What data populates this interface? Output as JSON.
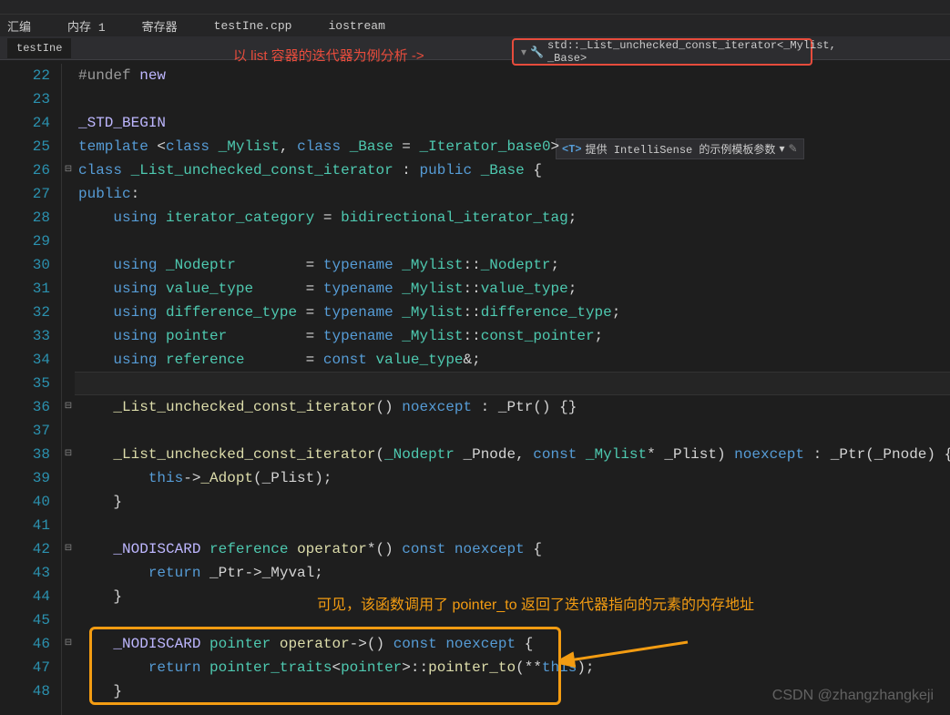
{
  "toolbar": {
    "items": [
      "汇编",
      "内存 1",
      "寄存器",
      "testIne.cpp",
      "iostream"
    ]
  },
  "tab": {
    "label": "testIne"
  },
  "annotation_top": "以 list 容器的迭代器为例分析 ->",
  "breadcrumb": {
    "text": "std::_List_unchecked_const_iterator<_Mylist, _Base>"
  },
  "hint": {
    "prefix": "<T>",
    "text": "提供 IntelliSense 的示例模板参数"
  },
  "line_start": 22,
  "lines": [
    [
      {
        "c": "pp",
        "t": "#undef"
      },
      {
        "c": "op",
        "t": " "
      },
      {
        "c": "mc",
        "t": "new"
      }
    ],
    [],
    [
      {
        "c": "mc",
        "t": "_STD_BEGIN"
      }
    ],
    [
      {
        "c": "kw",
        "t": "template"
      },
      {
        "c": "op",
        "t": " <"
      },
      {
        "c": "kw",
        "t": "class"
      },
      {
        "c": "op",
        "t": " "
      },
      {
        "c": "tp",
        "t": "_Mylist"
      },
      {
        "c": "op",
        "t": ", "
      },
      {
        "c": "kw",
        "t": "class"
      },
      {
        "c": "op",
        "t": " "
      },
      {
        "c": "tp",
        "t": "_Base"
      },
      {
        "c": "op",
        "t": " = "
      },
      {
        "c": "tp",
        "t": "_Iterator_base0"
      },
      {
        "c": "op",
        "t": ">"
      }
    ],
    [
      {
        "c": "kw",
        "t": "class"
      },
      {
        "c": "op",
        "t": " "
      },
      {
        "c": "tp",
        "t": "_List_unchecked_const_iterator"
      },
      {
        "c": "op",
        "t": " : "
      },
      {
        "c": "kw",
        "t": "public"
      },
      {
        "c": "op",
        "t": " "
      },
      {
        "c": "tp",
        "t": "_Base"
      },
      {
        "c": "op",
        "t": " {"
      }
    ],
    [
      {
        "c": "kw",
        "t": "public"
      },
      {
        "c": "op",
        "t": ":"
      }
    ],
    [
      {
        "c": "op",
        "t": "    "
      },
      {
        "c": "kw",
        "t": "using"
      },
      {
        "c": "op",
        "t": " "
      },
      {
        "c": "tp",
        "t": "iterator_category"
      },
      {
        "c": "op",
        "t": " = "
      },
      {
        "c": "tp",
        "t": "bidirectional_iterator_tag"
      },
      {
        "c": "op",
        "t": ";"
      }
    ],
    [],
    [
      {
        "c": "op",
        "t": "    "
      },
      {
        "c": "kw",
        "t": "using"
      },
      {
        "c": "op",
        "t": " "
      },
      {
        "c": "tp",
        "t": "_Nodeptr"
      },
      {
        "c": "op",
        "t": "        = "
      },
      {
        "c": "kw",
        "t": "typename"
      },
      {
        "c": "op",
        "t": " "
      },
      {
        "c": "tp",
        "t": "_Mylist"
      },
      {
        "c": "op",
        "t": "::"
      },
      {
        "c": "tp",
        "t": "_Nodeptr"
      },
      {
        "c": "op",
        "t": ";"
      }
    ],
    [
      {
        "c": "op",
        "t": "    "
      },
      {
        "c": "kw",
        "t": "using"
      },
      {
        "c": "op",
        "t": " "
      },
      {
        "c": "tp",
        "t": "value_type"
      },
      {
        "c": "op",
        "t": "      = "
      },
      {
        "c": "kw",
        "t": "typename"
      },
      {
        "c": "op",
        "t": " "
      },
      {
        "c": "tp",
        "t": "_Mylist"
      },
      {
        "c": "op",
        "t": "::"
      },
      {
        "c": "tp",
        "t": "value_type"
      },
      {
        "c": "op",
        "t": ";"
      }
    ],
    [
      {
        "c": "op",
        "t": "    "
      },
      {
        "c": "kw",
        "t": "using"
      },
      {
        "c": "op",
        "t": " "
      },
      {
        "c": "tp",
        "t": "difference_type"
      },
      {
        "c": "op",
        "t": " = "
      },
      {
        "c": "kw",
        "t": "typename"
      },
      {
        "c": "op",
        "t": " "
      },
      {
        "c": "tp",
        "t": "_Mylist"
      },
      {
        "c": "op",
        "t": "::"
      },
      {
        "c": "tp",
        "t": "difference_type"
      },
      {
        "c": "op",
        "t": ";"
      }
    ],
    [
      {
        "c": "op",
        "t": "    "
      },
      {
        "c": "kw",
        "t": "using"
      },
      {
        "c": "op",
        "t": " "
      },
      {
        "c": "tp",
        "t": "pointer"
      },
      {
        "c": "op",
        "t": "         = "
      },
      {
        "c": "kw",
        "t": "typename"
      },
      {
        "c": "op",
        "t": " "
      },
      {
        "c": "tp",
        "t": "_Mylist"
      },
      {
        "c": "op",
        "t": "::"
      },
      {
        "c": "tp",
        "t": "const_pointer"
      },
      {
        "c": "op",
        "t": ";"
      }
    ],
    [
      {
        "c": "op",
        "t": "    "
      },
      {
        "c": "kw",
        "t": "using"
      },
      {
        "c": "op",
        "t": " "
      },
      {
        "c": "tp",
        "t": "reference"
      },
      {
        "c": "op",
        "t": "       = "
      },
      {
        "c": "kw",
        "t": "const"
      },
      {
        "c": "op",
        "t": " "
      },
      {
        "c": "tp",
        "t": "value_type"
      },
      {
        "c": "op",
        "t": "&;"
      }
    ],
    [],
    [
      {
        "c": "op",
        "t": "    "
      },
      {
        "c": "fn",
        "t": "_List_unchecked_const_iterator"
      },
      {
        "c": "op",
        "t": "() "
      },
      {
        "c": "kw",
        "t": "noexcept"
      },
      {
        "c": "op",
        "t": " : "
      },
      {
        "c": "id",
        "t": "_Ptr"
      },
      {
        "c": "op",
        "t": "() {}"
      }
    ],
    [],
    [
      {
        "c": "op",
        "t": "    "
      },
      {
        "c": "fn",
        "t": "_List_unchecked_const_iterator"
      },
      {
        "c": "op",
        "t": "("
      },
      {
        "c": "tp",
        "t": "_Nodeptr"
      },
      {
        "c": "op",
        "t": " "
      },
      {
        "c": "id",
        "t": "_Pnode"
      },
      {
        "c": "op",
        "t": ", "
      },
      {
        "c": "kw",
        "t": "const"
      },
      {
        "c": "op",
        "t": " "
      },
      {
        "c": "tp",
        "t": "_Mylist"
      },
      {
        "c": "op",
        "t": "* "
      },
      {
        "c": "id",
        "t": "_Plist"
      },
      {
        "c": "op",
        "t": ") "
      },
      {
        "c": "kw",
        "t": "noexcept"
      },
      {
        "c": "op",
        "t": " : "
      },
      {
        "c": "id",
        "t": "_Ptr"
      },
      {
        "c": "op",
        "t": "("
      },
      {
        "c": "id",
        "t": "_Pnode"
      },
      {
        "c": "op",
        "t": ") {"
      }
    ],
    [
      {
        "c": "op",
        "t": "        "
      },
      {
        "c": "kw",
        "t": "this"
      },
      {
        "c": "op",
        "t": "->"
      },
      {
        "c": "fn",
        "t": "_Adopt"
      },
      {
        "c": "op",
        "t": "("
      },
      {
        "c": "id",
        "t": "_Plist"
      },
      {
        "c": "op",
        "t": ");"
      }
    ],
    [
      {
        "c": "op",
        "t": "    }"
      }
    ],
    [],
    [
      {
        "c": "op",
        "t": "    "
      },
      {
        "c": "mc",
        "t": "_NODISCARD"
      },
      {
        "c": "op",
        "t": " "
      },
      {
        "c": "tp",
        "t": "reference"
      },
      {
        "c": "op",
        "t": " "
      },
      {
        "c": "fn",
        "t": "operator"
      },
      {
        "c": "op",
        "t": "*() "
      },
      {
        "c": "kw",
        "t": "const"
      },
      {
        "c": "op",
        "t": " "
      },
      {
        "c": "kw",
        "t": "noexcept"
      },
      {
        "c": "op",
        "t": " {"
      }
    ],
    [
      {
        "c": "op",
        "t": "        "
      },
      {
        "c": "kw",
        "t": "return"
      },
      {
        "c": "op",
        "t": " "
      },
      {
        "c": "id",
        "t": "_Ptr"
      },
      {
        "c": "op",
        "t": "->"
      },
      {
        "c": "id",
        "t": "_Myval"
      },
      {
        "c": "op",
        "t": ";"
      }
    ],
    [
      {
        "c": "op",
        "t": "    }"
      }
    ],
    [],
    [
      {
        "c": "op",
        "t": "    "
      },
      {
        "c": "mc",
        "t": "_NODISCARD"
      },
      {
        "c": "op",
        "t": " "
      },
      {
        "c": "tp",
        "t": "pointer"
      },
      {
        "c": "op",
        "t": " "
      },
      {
        "c": "fn",
        "t": "operator"
      },
      {
        "c": "op",
        "t": "->() "
      },
      {
        "c": "kw",
        "t": "const"
      },
      {
        "c": "op",
        "t": " "
      },
      {
        "c": "kw",
        "t": "noexcept"
      },
      {
        "c": "op",
        "t": " {"
      }
    ],
    [
      {
        "c": "op",
        "t": "        "
      },
      {
        "c": "kw",
        "t": "return"
      },
      {
        "c": "op",
        "t": " "
      },
      {
        "c": "tp",
        "t": "pointer_traits"
      },
      {
        "c": "op",
        "t": "<"
      },
      {
        "c": "tp",
        "t": "pointer"
      },
      {
        "c": "op",
        "t": ">::"
      },
      {
        "c": "fn",
        "t": "pointer_to"
      },
      {
        "c": "op",
        "t": "(**"
      },
      {
        "c": "kw",
        "t": "this"
      },
      {
        "c": "op",
        "t": ");"
      }
    ],
    [
      {
        "c": "op",
        "t": "    }"
      }
    ]
  ],
  "fold_marks": {
    "26": "⊟",
    "36": "⊟",
    "38": "⊟",
    "42": "⊟",
    "46": "⊟"
  },
  "annotation_orange": "可见，该函数调用了 pointer_to 返回了迭代器指向的元素的内存地址",
  "watermark": "CSDN @zhangzhangkeji"
}
